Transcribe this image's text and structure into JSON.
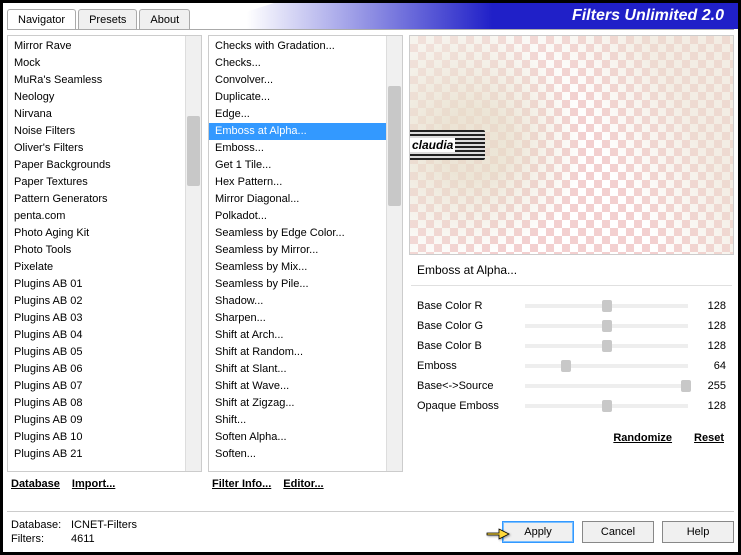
{
  "header": {
    "tabs": [
      "Navigator",
      "Presets",
      "About"
    ],
    "active_tab": 0,
    "title": "Filters Unlimited 2.0"
  },
  "left_list": {
    "items": [
      "Mirror Rave",
      "Mock",
      "MuRa's Seamless",
      "Neology",
      "Nirvana",
      "Noise Filters",
      "Oliver's Filters",
      "Paper Backgrounds",
      "Paper Textures",
      "Pattern Generators",
      "penta.com",
      "Photo Aging Kit",
      "Photo Tools",
      "Pixelate",
      "Plugins AB 01",
      "Plugins AB 02",
      "Plugins AB 03",
      "Plugins AB 04",
      "Plugins AB 05",
      "Plugins AB 06",
      "Plugins AB 07",
      "Plugins AB 08",
      "Plugins AB 09",
      "Plugins AB 10",
      "Plugins AB 21"
    ],
    "highlight_index": 2,
    "buttons": {
      "database": "Database",
      "import": "Import..."
    }
  },
  "mid_list": {
    "items": [
      "Checks with Gradation...",
      "Checks...",
      "Convolver...",
      "Duplicate...",
      "Edge...",
      "Emboss at Alpha...",
      "Emboss...",
      "Get 1 Tile...",
      "Hex Pattern...",
      "Mirror Diagonal...",
      "Polkadot...",
      "Seamless by Edge Color...",
      "Seamless by Mirror...",
      "Seamless by Mix...",
      "Seamless by Pile...",
      "Shadow...",
      "Sharpen...",
      "Shift at Arch...",
      "Shift at Random...",
      "Shift at Slant...",
      "Shift at Wave...",
      "Shift at Zigzag...",
      "Shift...",
      "Soften Alpha...",
      "Soften..."
    ],
    "selected_index": 5,
    "buttons": {
      "filter_info": "Filter Info...",
      "editor": "Editor..."
    }
  },
  "watermark": "claudia",
  "filter_name": "Emboss at Alpha...",
  "params": [
    {
      "label": "Base Color R",
      "value": 128,
      "pos": 50
    },
    {
      "label": "Base Color G",
      "value": 128,
      "pos": 50
    },
    {
      "label": "Base Color B",
      "value": 128,
      "pos": 50
    },
    {
      "label": "Emboss",
      "value": 64,
      "pos": 25
    },
    {
      "label": "Base<->Source",
      "value": 255,
      "pos": 99
    },
    {
      "label": "Opaque Emboss",
      "value": 128,
      "pos": 50
    }
  ],
  "right_buttons": {
    "randomize": "Randomize",
    "reset": "Reset"
  },
  "footer": {
    "database_label": "Database:",
    "database_value": "ICNET-Filters",
    "filters_label": "Filters:",
    "filters_value": "4611",
    "apply": "Apply",
    "cancel": "Cancel",
    "help": "Help"
  }
}
